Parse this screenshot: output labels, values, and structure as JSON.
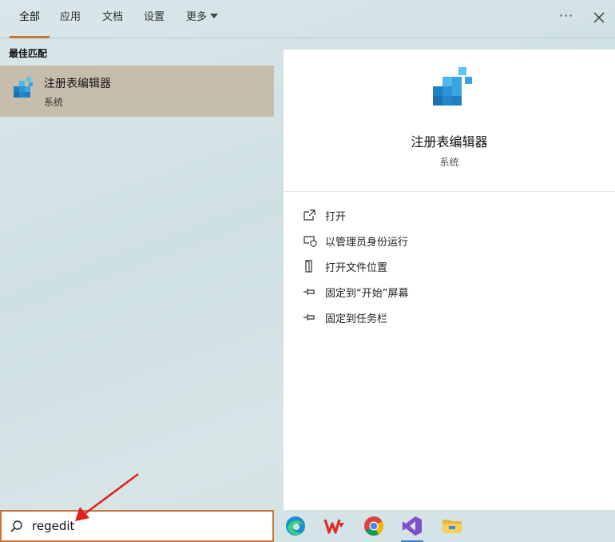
{
  "tabs": {
    "all": "全部",
    "apps": "应用",
    "documents": "文档",
    "settings": "设置",
    "more": "更多"
  },
  "header": {
    "more_options": "···"
  },
  "best_match": {
    "title": "最佳匹配",
    "result": {
      "name": "注册表编辑器",
      "type": "系统",
      "icon": "registry-editor-icon"
    }
  },
  "detail": {
    "name": "注册表编辑器",
    "type": "系统",
    "actions": [
      {
        "label": "打开",
        "icon": "open-icon"
      },
      {
        "label": "以管理员身份运行",
        "icon": "shield-run-icon"
      },
      {
        "label": "打开文件位置",
        "icon": "file-location-icon"
      },
      {
        "label": "固定到“开始”屏幕",
        "icon": "pin-icon"
      },
      {
        "label": "固定到任务栏",
        "icon": "pin-icon"
      }
    ]
  },
  "search": {
    "value": "regedit",
    "icon": "search-icon"
  },
  "taskbar": {
    "apps": [
      "edge-icon",
      "wps-icon",
      "chrome-icon",
      "visual-studio-icon",
      "file-explorer-icon"
    ]
  },
  "colors": {
    "accent": "#c9753a",
    "selection": "#c7bdad",
    "arrow": "#e0201b"
  }
}
